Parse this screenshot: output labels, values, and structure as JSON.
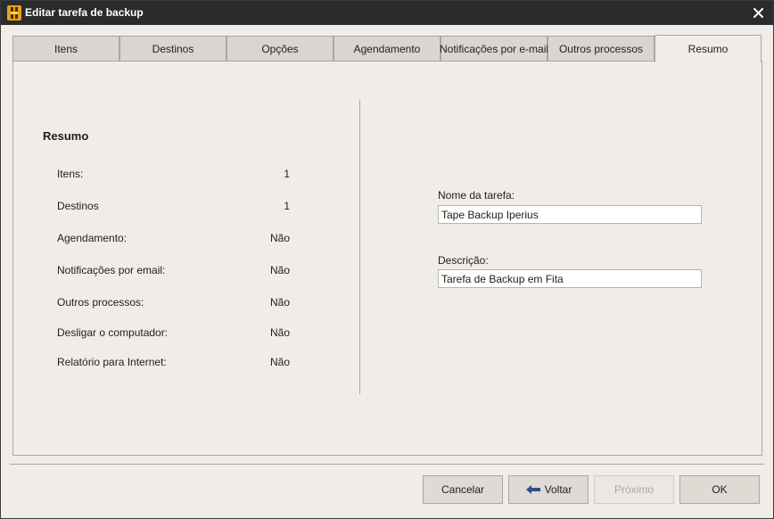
{
  "window": {
    "title": "Editar tarefa de backup",
    "icons": {
      "app": "iperius-app-icon",
      "close": "close-icon"
    }
  },
  "tabs": [
    {
      "label": "Itens",
      "active": false
    },
    {
      "label": "Destinos",
      "active": false
    },
    {
      "label": "Opções",
      "active": false
    },
    {
      "label": "Agendamento",
      "active": false
    },
    {
      "label": "Notificações por e-mail",
      "active": false
    },
    {
      "label": "Outros processos",
      "active": false
    },
    {
      "label": "Resumo",
      "active": true
    }
  ],
  "summary": {
    "title": "Resumo",
    "rows": [
      {
        "label": "Itens:",
        "value": "1"
      },
      {
        "label": "Destinos",
        "value": "1"
      },
      {
        "label": "Agendamento:",
        "value": "Não"
      },
      {
        "label": "Notificações por email:",
        "value": "Não"
      },
      {
        "label": "Outros processos:",
        "value": "Não"
      },
      {
        "label": "Desligar o computador:",
        "value": "Não"
      },
      {
        "label": "Relatório para Internet:",
        "value": "Não"
      }
    ]
  },
  "form": {
    "task_name_label": "Nome da tarefa:",
    "task_name_value": "Tape Backup Iperius",
    "description_label": "Descrição:",
    "description_value": "Tarefa de Backup em Fita"
  },
  "buttons": {
    "cancel": "Cancelar",
    "back": "Voltar",
    "next": "Próximo",
    "ok": "OK",
    "back_icon": "arrow-left-icon"
  },
  "colors": {
    "titlebar": "#2b2b2b",
    "window_bg": "#f0ede8",
    "back_arrow": "#2f4e8c"
  }
}
